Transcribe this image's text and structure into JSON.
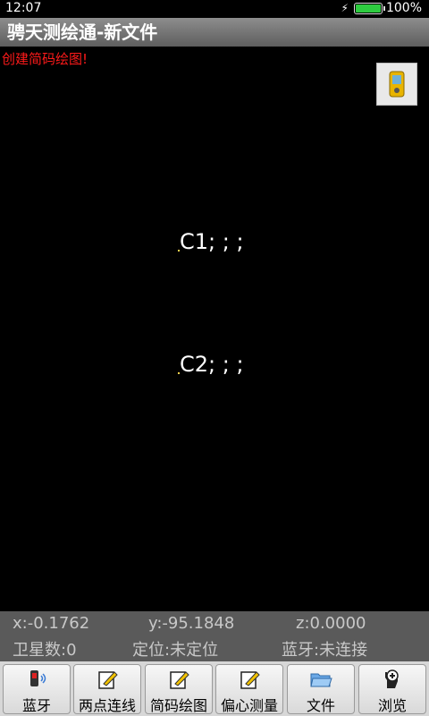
{
  "status": {
    "time": "12:07",
    "battery": "100%",
    "battery_level": 1.0
  },
  "app": {
    "title": "骋天测绘通-新文件"
  },
  "canvas": {
    "hint": "创建简码绘图!",
    "points": [
      {
        "label": "C1; ; ;"
      },
      {
        "label": "C2; ; ;"
      }
    ]
  },
  "coords": {
    "x": "x:-0.1762",
    "y": "y:-95.1848",
    "z": "z:0.0000",
    "satellites": "卫星数:0",
    "fix": "定位:未定位",
    "bluetooth": "蓝牙:未连接"
  },
  "toolbar": {
    "bluetooth": "蓝牙",
    "two_point_line": "两点连线",
    "code_drawing": "简码绘图",
    "offset_measure": "偏心测量",
    "file": "文件",
    "browse": "浏览"
  }
}
